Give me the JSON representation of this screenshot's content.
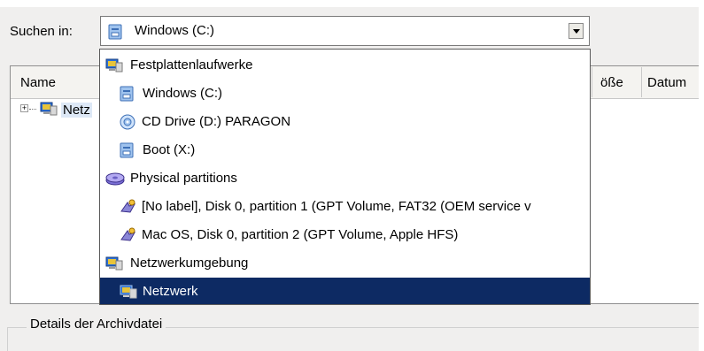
{
  "look_in": {
    "label": "Suchen in:",
    "selected": "Windows (C:)"
  },
  "file_list": {
    "columns": [
      {
        "name": "Name"
      },
      {
        "name": "öße"
      },
      {
        "name": "Datum"
      }
    ],
    "tree": {
      "expander": "+",
      "node_label": "Netz"
    }
  },
  "dropdown": {
    "items": [
      {
        "label": "Festplattenlaufwerke",
        "icon": "hard-drives-group-icon",
        "level": 0
      },
      {
        "label": "Windows (C:)",
        "icon": "drive-icon",
        "level": 1
      },
      {
        "label": "CD Drive (D:) PARAGON",
        "icon": "cd-drive-icon",
        "level": 1
      },
      {
        "label": "Boot (X:)",
        "icon": "drive-icon",
        "level": 1
      },
      {
        "label": "Physical partitions",
        "icon": "physical-partitions-icon",
        "level": 0
      },
      {
        "label": "[No label], Disk 0, partition 1 (GPT Volume, FAT32 (OEM service v",
        "icon": "partition-icon",
        "level": 1
      },
      {
        "label": "Mac OS, Disk 0, partition 2 (GPT Volume, Apple HFS)",
        "icon": "partition-icon",
        "level": 1
      },
      {
        "label": "Netzwerkumgebung",
        "icon": "network-places-icon",
        "level": 0
      },
      {
        "label": "Netzwerk",
        "icon": "network-icon",
        "level": 1,
        "selected": true
      }
    ]
  },
  "details_group": {
    "label": "Details der Archivdatei"
  },
  "colors": {
    "highlight": "#0d2a63",
    "window_bg": "#f0efee"
  }
}
